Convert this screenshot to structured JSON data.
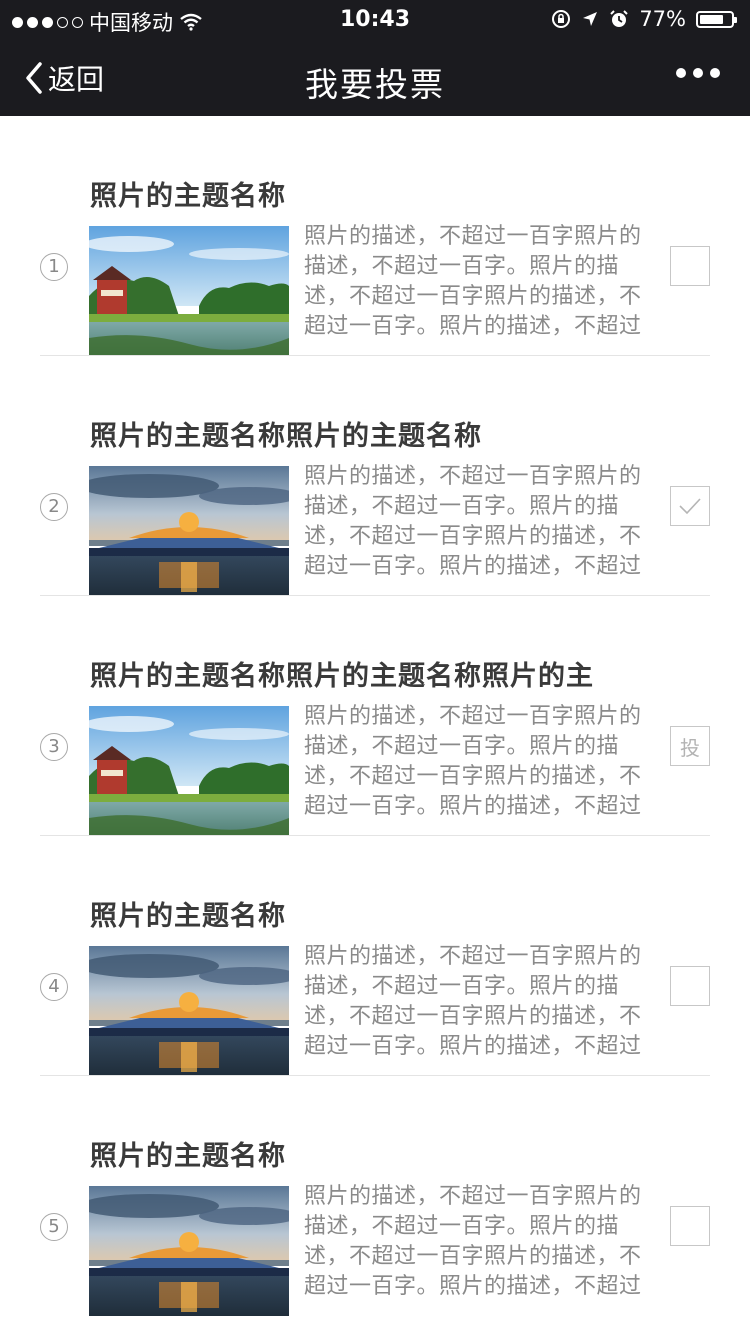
{
  "status_bar": {
    "carrier": "中国移动",
    "time": "10:43",
    "battery": "77%",
    "battery_level": 0.77
  },
  "nav": {
    "back_label": "返回",
    "title": "我要投票"
  },
  "items": [
    {
      "index": "1",
      "title": "照片的主题名称",
      "description": "照片的描述，不超过一百字照片的描述，不超过一百字。照片的描述，不超过一百字照片的描述，不超过一百字。照片的描述，不超过",
      "image": "pavilion-lake",
      "state": "unchecked"
    },
    {
      "index": "2",
      "title": "照片的主题名称照片的主题名称",
      "description": "照片的描述，不超过一百字照片的描述，不超过一百字。照片的描述，不超过一百字照片的描述，不超过一百字。照片的描述，不超过",
      "image": "lit-building",
      "state": "checked"
    },
    {
      "index": "3",
      "title": "照片的主题名称照片的主题名称照片的主",
      "description": "照片的描述，不超过一百字照片的描述，不超过一百字。照片的描述，不超过一百字照片的描述，不超过一百字。照片的描述，不超过",
      "image": "pavilion-lake",
      "state": "vote",
      "vote_label": "投"
    },
    {
      "index": "4",
      "title": "照片的主题名称",
      "description": "照片的描述，不超过一百字照片的描述，不超过一百字。照片的描述，不超过一百字照片的描述，不超过一百字。照片的描述，不超过",
      "image": "lit-building",
      "state": "unchecked"
    },
    {
      "index": "5",
      "title": "照片的主题名称",
      "description": "照片的描述，不超过一百字照片的描述，不超过一百字。照片的描述，不超过一百字照片的描述，不超过一百字。照片的描述，不超过",
      "image": "lit-building",
      "state": "unchecked"
    }
  ]
}
